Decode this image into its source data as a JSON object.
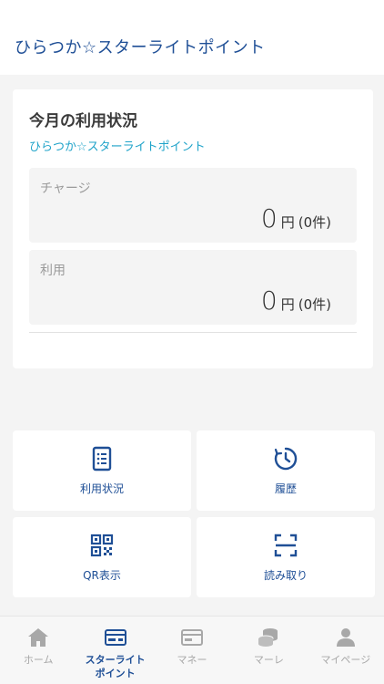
{
  "header": {
    "title": "ひらつか☆スターライトポイント"
  },
  "usage": {
    "title": "今月の利用状況",
    "point_name": "ひらつか☆スターライトポイント",
    "charge": {
      "label": "チャージ",
      "amount": "0",
      "unit": "円",
      "count": "(0件)"
    },
    "use": {
      "label": "利用",
      "amount": "0",
      "unit": "円",
      "count": "(0件)"
    }
  },
  "menu": [
    {
      "label": "利用状況",
      "icon": "document-list-icon"
    },
    {
      "label": "履歴",
      "icon": "clock-history-icon"
    },
    {
      "label": "QR表示",
      "icon": "qr-code-icon"
    },
    {
      "label": "読み取り",
      "icon": "scan-frame-icon"
    }
  ],
  "tabbar": {
    "items": [
      {
        "label": "ホーム",
        "icon": "home-icon"
      },
      {
        "label": "スターライト",
        "label2": "ポイント",
        "icon": "card-icon"
      },
      {
        "label": "マネー",
        "icon": "money-card-icon"
      },
      {
        "label": "マーレ",
        "icon": "coins-icon"
      },
      {
        "label": "マイページ",
        "icon": "user-icon"
      }
    ],
    "active_index": 1
  },
  "colors": {
    "brand": "#1f4f96",
    "accent": "#1fa3c9",
    "inactive": "#a8a8a8"
  }
}
